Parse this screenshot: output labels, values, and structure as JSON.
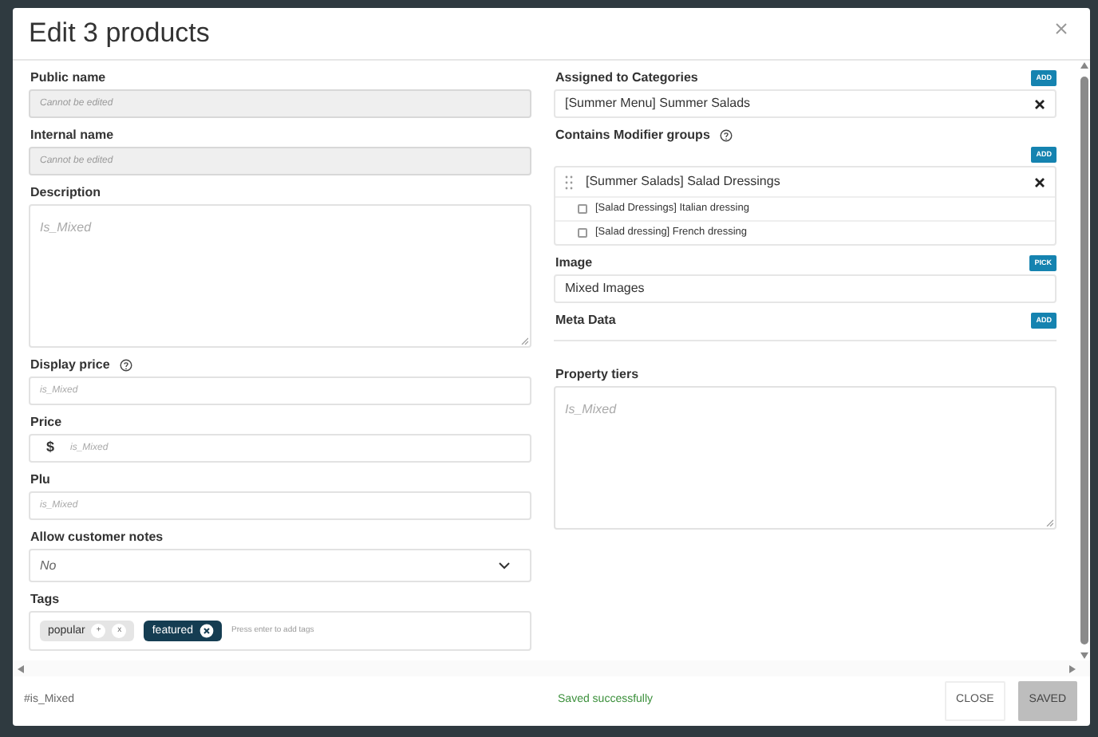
{
  "window": {
    "title": "Edit 3 products"
  },
  "left_fields": [
    {
      "kind": "input",
      "label": "Public name",
      "help": false,
      "placeholder": "Cannot be edited",
      "disabled": true
    },
    {
      "kind": "input",
      "label": "Internal name",
      "help": false,
      "placeholder": "Cannot be edited",
      "disabled": true
    },
    {
      "kind": "textarea",
      "label": "Description",
      "help": false,
      "placeholder": "Is_Mixed",
      "disabled": false
    },
    {
      "kind": "input",
      "label": "Display price",
      "help": true,
      "placeholder": "is_Mixed",
      "disabled": false
    },
    {
      "kind": "money",
      "label": "Price",
      "help": false,
      "prefix": "$",
      "placeholder": "is_Mixed",
      "disabled": false
    },
    {
      "kind": "input",
      "label": "Plu",
      "help": false,
      "placeholder": "is_Mixed",
      "disabled": false
    },
    {
      "kind": "select",
      "label": "Allow customer notes",
      "help": false,
      "value": "No",
      "disabled": false
    },
    {
      "kind": "tags",
      "label": "Tags",
      "help": false,
      "placeholder": "Press enter to add tags",
      "disabled": false,
      "tags": [
        {
          "label": "popular",
          "selected": false,
          "actions": [
            "+",
            "x"
          ]
        },
        {
          "label": "featured",
          "selected": true
        }
      ]
    }
  ],
  "right_sections": [
    {
      "kind": "list",
      "label": "Assigned to Categories",
      "help": false,
      "action": "ADD",
      "items": [
        {
          "text": "[Summer Menu] Summer Salads",
          "removable": true
        }
      ]
    },
    {
      "kind": "groups",
      "label": "Contains Modifier groups",
      "help": true,
      "action": "ADD",
      "groups": [
        {
          "text": "[Summer Salads] Salad Dressings",
          "children": [
            {
              "text": "[Salad Dressings] Italian dressing",
              "checked": false
            },
            {
              "text": "[Salad dressing] French dressing",
              "checked": false
            }
          ]
        }
      ]
    },
    {
      "kind": "list",
      "label": "Image",
      "help": false,
      "action": "PICK",
      "items": [
        {
          "text": "Mixed Images",
          "removable": false
        }
      ]
    },
    {
      "kind": "list",
      "label": "Meta Data",
      "help": false,
      "action": "ADD"
    },
    {
      "kind": "textarea",
      "label": "Property tiers",
      "help": false,
      "placeholder": "Is_Mixed"
    }
  ],
  "footer": {
    "hash": "#is_Mixed",
    "status": "Saved successfully",
    "buttons": [
      {
        "label": "CLOSE",
        "disabled": false
      },
      {
        "label": "SAVED",
        "disabled": true
      }
    ]
  }
}
